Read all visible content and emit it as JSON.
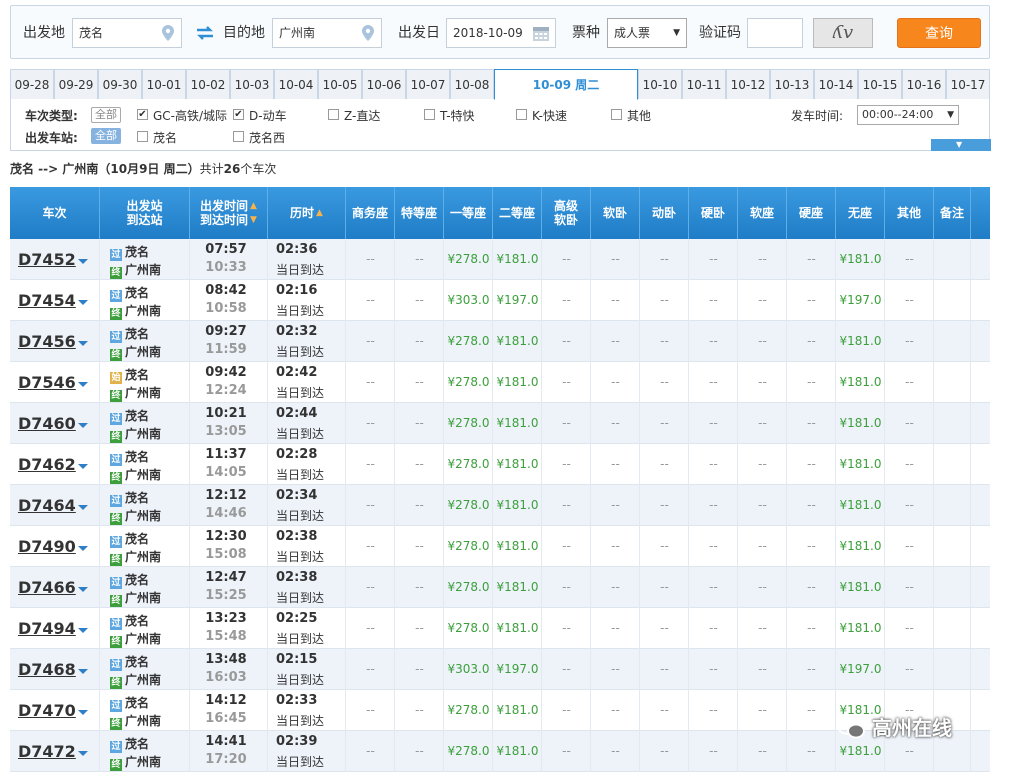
{
  "search": {
    "from_label": "出发地",
    "from_value": "茂名",
    "to_label": "目的地",
    "to_value": "广州南",
    "date_label": "出发日",
    "date_value": "2018-10-09",
    "ticket_label": "票种",
    "ticket_value": "成人票",
    "captcha_label": "验证码",
    "captcha_text": "ʎv",
    "query_button": "查询"
  },
  "dates": [
    {
      "label": "09-28"
    },
    {
      "label": "09-29"
    },
    {
      "label": "09-30"
    },
    {
      "label": "10-01"
    },
    {
      "label": "10-02"
    },
    {
      "label": "10-03"
    },
    {
      "label": "10-04"
    },
    {
      "label": "10-05"
    },
    {
      "label": "10-06"
    },
    {
      "label": "10-07"
    },
    {
      "label": "10-08"
    },
    {
      "label": "10-09 周二",
      "active": true
    },
    {
      "label": "10-10"
    },
    {
      "label": "10-11"
    },
    {
      "label": "10-12"
    },
    {
      "label": "10-13"
    },
    {
      "label": "10-14"
    },
    {
      "label": "10-15"
    },
    {
      "label": "10-16"
    },
    {
      "label": "10-17"
    }
  ],
  "filter": {
    "type_label": "车次类型:",
    "all_label": "全部",
    "types": [
      {
        "label": "GC-高铁/城际",
        "checked": true
      },
      {
        "label": "D-动车",
        "checked": true
      },
      {
        "label": "Z-直达",
        "checked": false
      },
      {
        "label": "T-特快",
        "checked": false
      },
      {
        "label": "K-快速",
        "checked": false
      },
      {
        "label": "其他",
        "checked": false
      }
    ],
    "station_label": "出发车站:",
    "stations": [
      {
        "label": "茂名",
        "checked": false
      },
      {
        "label": "茂名西",
        "checked": false
      }
    ],
    "time_label": "发车时间:",
    "time_value": "00:00--24:00"
  },
  "summary": {
    "route": "茂名 --> 广州南（10月9日  周二）",
    "prefix": "共计",
    "count": "26",
    "suffix": "个车次"
  },
  "columns": {
    "train": "车次",
    "station": "出发站\n到达站",
    "time": "出发时间\n到达时间",
    "duration": "历时",
    "business": "商务座",
    "premium": "特等座",
    "first": "一等座",
    "second": "二等座",
    "adv_soft_sleeper": "高级\n软卧",
    "soft_sleeper": "软卧",
    "moving_sleeper": "动卧",
    "hard_sleeper": "硬卧",
    "soft_seat": "软座",
    "hard_seat": "硬座",
    "no_seat": "无座",
    "other": "其他",
    "remark": "备注"
  },
  "badges": {
    "guo": "过",
    "shi": "始",
    "zhong": "终"
  },
  "rows": [
    {
      "train": "D7452",
      "from_badge": "过",
      "from": "茂名",
      "to": "广州南",
      "dep": "07:57",
      "arr": "10:33",
      "dur": "02:36",
      "day": "当日到达",
      "first": "¥278.0",
      "second": "¥181.0",
      "noseat": "¥181.0"
    },
    {
      "train": "D7454",
      "from_badge": "过",
      "from": "茂名",
      "to": "广州南",
      "dep": "08:42",
      "arr": "10:58",
      "dur": "02:16",
      "day": "当日到达",
      "first": "¥303.0",
      "second": "¥197.0",
      "noseat": "¥197.0"
    },
    {
      "train": "D7456",
      "from_badge": "过",
      "from": "茂名",
      "to": "广州南",
      "dep": "09:27",
      "arr": "11:59",
      "dur": "02:32",
      "day": "当日到达",
      "first": "¥278.0",
      "second": "¥181.0",
      "noseat": "¥181.0"
    },
    {
      "train": "D7546",
      "from_badge": "始",
      "from": "茂名",
      "to": "广州南",
      "dep": "09:42",
      "arr": "12:24",
      "dur": "02:42",
      "day": "当日到达",
      "first": "¥278.0",
      "second": "¥181.0",
      "noseat": "¥181.0"
    },
    {
      "train": "D7460",
      "from_badge": "过",
      "from": "茂名",
      "to": "广州南",
      "dep": "10:21",
      "arr": "13:05",
      "dur": "02:44",
      "day": "当日到达",
      "first": "¥278.0",
      "second": "¥181.0",
      "noseat": "¥181.0"
    },
    {
      "train": "D7462",
      "from_badge": "过",
      "from": "茂名",
      "to": "广州南",
      "dep": "11:37",
      "arr": "14:05",
      "dur": "02:28",
      "day": "当日到达",
      "first": "¥278.0",
      "second": "¥181.0",
      "noseat": "¥181.0"
    },
    {
      "train": "D7464",
      "from_badge": "过",
      "from": "茂名",
      "to": "广州南",
      "dep": "12:12",
      "arr": "14:46",
      "dur": "02:34",
      "day": "当日到达",
      "first": "¥278.0",
      "second": "¥181.0",
      "noseat": "¥181.0"
    },
    {
      "train": "D7490",
      "from_badge": "过",
      "from": "茂名",
      "to": "广州南",
      "dep": "12:30",
      "arr": "15:08",
      "dur": "02:38",
      "day": "当日到达",
      "first": "¥278.0",
      "second": "¥181.0",
      "noseat": "¥181.0"
    },
    {
      "train": "D7466",
      "from_badge": "过",
      "from": "茂名",
      "to": "广州南",
      "dep": "12:47",
      "arr": "15:25",
      "dur": "02:38",
      "day": "当日到达",
      "first": "¥278.0",
      "second": "¥181.0",
      "noseat": "¥181.0"
    },
    {
      "train": "D7494",
      "from_badge": "过",
      "from": "茂名",
      "to": "广州南",
      "dep": "13:23",
      "arr": "15:48",
      "dur": "02:25",
      "day": "当日到达",
      "first": "¥278.0",
      "second": "¥181.0",
      "noseat": "¥181.0"
    },
    {
      "train": "D7468",
      "from_badge": "过",
      "from": "茂名",
      "to": "广州南",
      "dep": "13:48",
      "arr": "16:03",
      "dur": "02:15",
      "day": "当日到达",
      "first": "¥303.0",
      "second": "¥197.0",
      "noseat": "¥197.0"
    },
    {
      "train": "D7470",
      "from_badge": "过",
      "from": "茂名",
      "to": "广州南",
      "dep": "14:12",
      "arr": "16:45",
      "dur": "02:33",
      "day": "当日到达",
      "first": "¥278.0",
      "second": "¥181.0",
      "noseat": "¥181.0"
    },
    {
      "train": "D7472",
      "from_badge": "过",
      "from": "茂名",
      "to": "广州南",
      "dep": "14:41",
      "arr": "17:20",
      "dur": "02:39",
      "day": "当日到达",
      "first": "¥278.0",
      "second": "¥181.0",
      "noseat": "¥181.0"
    }
  ],
  "empty_value": "--",
  "watermark": "高州在线",
  "colors": {
    "accent": "#2f8ed4",
    "query_button": "#f7861c",
    "price": "#3c9f3c"
  }
}
